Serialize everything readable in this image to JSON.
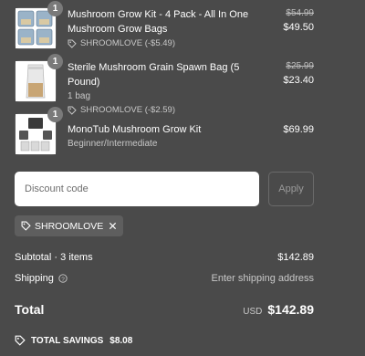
{
  "items": [
    {
      "name": "Mushroom Grow Kit - 4 Pack - All In One Mushroom Grow Bags",
      "quantity": "1",
      "discount": "SHROOMLOVE (-$5.49)",
      "original_price": "$54.99",
      "price": "$49.50",
      "thumb_icon": "grow-bags-4-pack-image"
    },
    {
      "name": "Sterile Mushroom Grain Spawn Bag (5 Pound)",
      "quantity": "1",
      "variant": "1 bag",
      "discount": "SHROOMLOVE (-$2.59)",
      "original_price": "$25.99",
      "price": "$23.40",
      "thumb_icon": "grain-spawn-bag-image"
    },
    {
      "name": "MonoTub Mushroom Grow Kit",
      "quantity": "1",
      "variant": "Beginner/Intermediate",
      "price": "$69.99",
      "thumb_icon": "monotub-kit-image"
    }
  ],
  "discount_code": {
    "placeholder": "Discount code",
    "value": "",
    "apply_label": "Apply"
  },
  "applied_code": "SHROOMLOVE",
  "summary": {
    "subtotal_label": "Subtotal · 3 items",
    "subtotal_value": "$142.89",
    "shipping_label": "Shipping",
    "shipping_value": "Enter shipping address",
    "total_label": "Total",
    "currency": "USD",
    "total_value": "$142.89",
    "savings_label": "TOTAL SAVINGS",
    "savings_value": "$8.08"
  },
  "colors": {
    "background": "#4a4a4a",
    "text": "#ffffff",
    "muted_text": "#c8c8c8",
    "badge": "#7a7a7a",
    "chip": "#5e5e5e"
  }
}
